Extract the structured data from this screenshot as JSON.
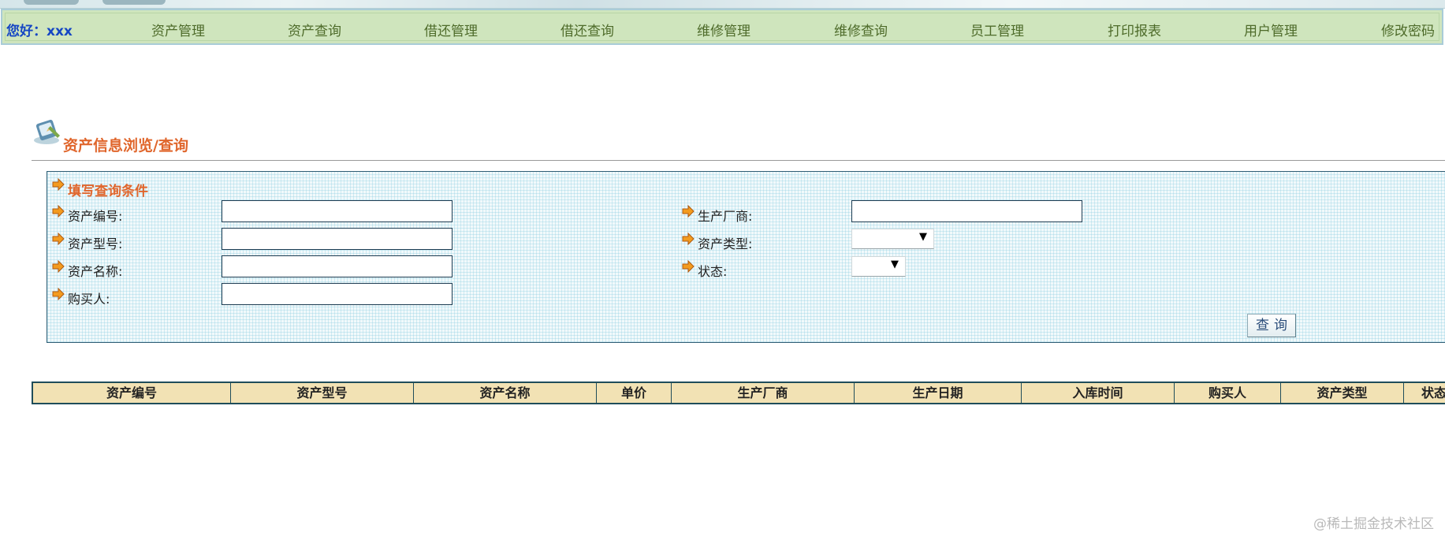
{
  "header": {
    "greeting": "您好：xxx",
    "nav": [
      "资产管理",
      "资产查询",
      "借还管理",
      "借还查询",
      "维修管理",
      "维修查询",
      "员工管理",
      "打印报表",
      "用户管理",
      "修改密码"
    ]
  },
  "page": {
    "title": "资产信息浏览/查询"
  },
  "query": {
    "section_title": "填写查询条件",
    "fields": {
      "asset_no": {
        "label": "资产编号:",
        "value": ""
      },
      "asset_model": {
        "label": "资产型号:",
        "value": ""
      },
      "asset_name": {
        "label": "资产名称:",
        "value": ""
      },
      "buyer": {
        "label": "购买人:",
        "value": ""
      },
      "manufacturer": {
        "label": "生产厂商:",
        "value": ""
      },
      "asset_type": {
        "label": "资产类型:",
        "value": ""
      },
      "status": {
        "label": "状态:",
        "value": ""
      }
    },
    "button": "查询"
  },
  "table": {
    "columns": [
      "资产编号",
      "资产型号",
      "资产名称",
      "单价",
      "生产厂商",
      "生产日期",
      "入库时间",
      "购买人",
      "资产类型",
      "状态"
    ]
  },
  "watermark": "@稀土掘金技术社区"
}
